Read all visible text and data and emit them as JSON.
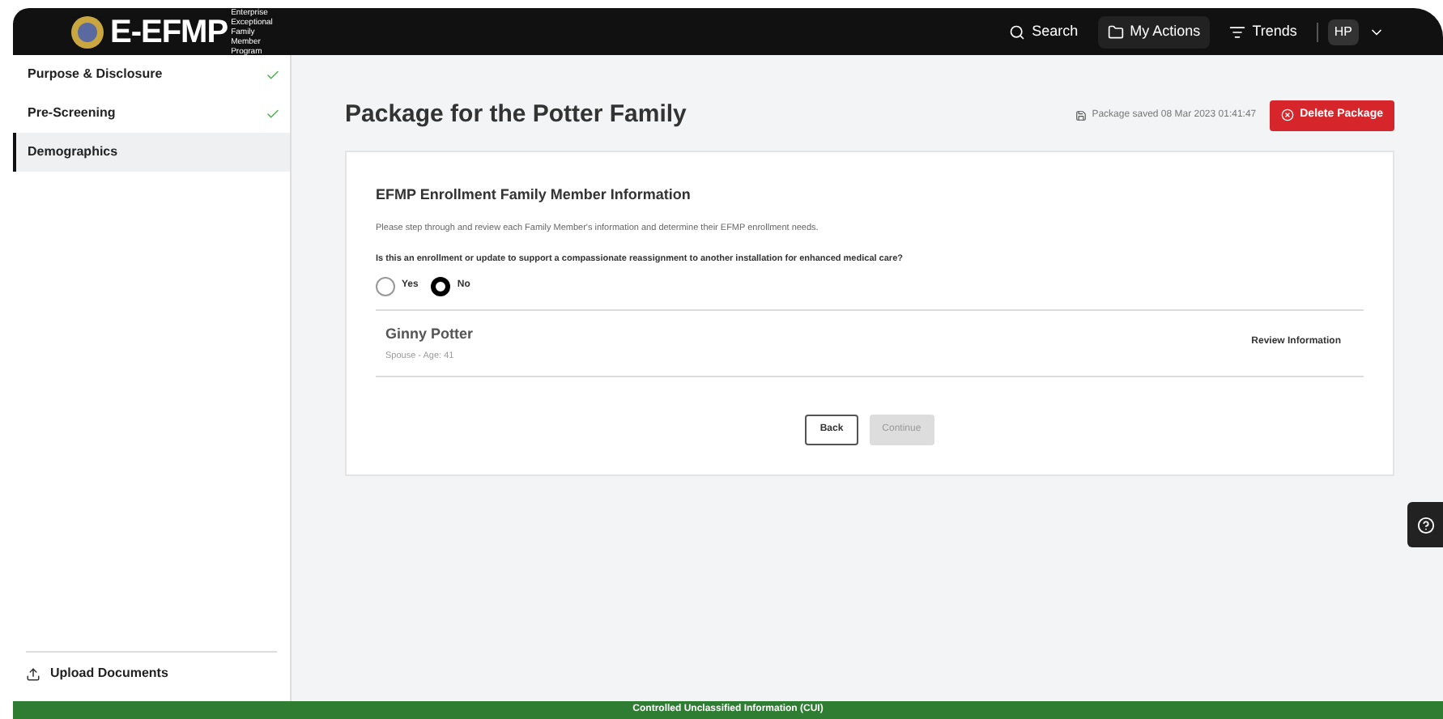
{
  "header": {
    "brand": "E-EFMP",
    "brand_sub": "Enterprise Exceptional Family Member Program",
    "nav": [
      {
        "label": "Search",
        "kind": "search",
        "selected": false
      },
      {
        "label": "My Actions",
        "kind": "folder",
        "selected": true
      },
      {
        "label": "Trends",
        "kind": "list",
        "selected": false
      }
    ],
    "user": "HP"
  },
  "sidebar": {
    "items": [
      {
        "label": "Purpose & Disclosure",
        "complete": true,
        "selected": false
      },
      {
        "label": "Pre-Screening",
        "complete": true,
        "selected": false
      },
      {
        "label": "Demographics",
        "complete": false,
        "selected": true
      }
    ],
    "upload": "Upload Documents"
  },
  "page": {
    "title": "Package for the Potter Family",
    "saved": "Package saved 08 Mar 2023 01:41:47",
    "delete": "Delete Package"
  },
  "card": {
    "title": "EFMP Enrollment Family Member Information",
    "intro": "Please step through and review each Family Member's information and determine their EFMP enrollment needs.",
    "question": "Is this an enrollment or update to support a compassionate reassignment to another installation for enhanced medical care?",
    "options": [
      {
        "label": "Yes",
        "selected": false
      },
      {
        "label": "No",
        "selected": true
      }
    ],
    "members": [
      {
        "name": "Ginny Potter",
        "detail": "Spouse - Age: 41",
        "action": "Review Information"
      }
    ],
    "back": "Back",
    "continue": {
      "label": "Continue",
      "disabled": true
    }
  },
  "footer": "Controlled Unclassified Information (CUI)"
}
